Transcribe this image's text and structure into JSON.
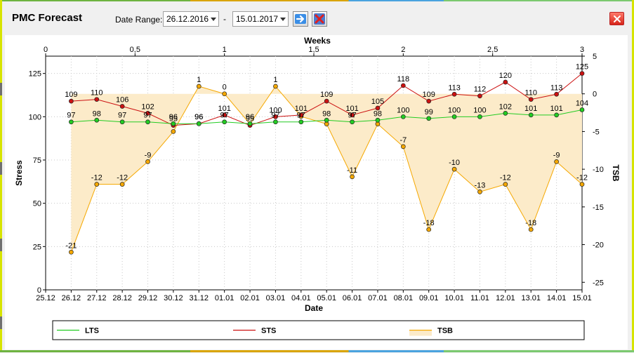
{
  "window": {
    "title": "PMC Forecast",
    "close_icon": "close-icon"
  },
  "toolbar": {
    "date_range_label": "Date Range:",
    "start_date": "26.12.2016",
    "separator": "-",
    "end_date": "15.01.2017",
    "apply_icon": "arrow-right-icon",
    "clear_icon": "red-x-icon"
  },
  "chart_data": {
    "type": "line",
    "title": "",
    "xlabel": "Date",
    "ylabel": "Stress",
    "y2label": "TSB",
    "top_axis_label": "Weeks",
    "categories": [
      "26.12",
      "27.12",
      "28.12",
      "29.12",
      "30.12",
      "31.12",
      "01.01",
      "02.01",
      "03.01",
      "04.01",
      "05.01",
      "06.01",
      "07.01",
      "08.01",
      "09.01",
      "10.01",
      "11.01",
      "12.01",
      "13.01",
      "14.01",
      "15.01"
    ],
    "x_tick_labels": [
      "25.12",
      "26.12",
      "27.12",
      "28.12",
      "29.12",
      "30.12",
      "31.12",
      "01.01",
      "02.01",
      "03.01",
      "04.01",
      "05.01",
      "06.01",
      "07.01",
      "08.01",
      "09.01",
      "10.01",
      "11.01",
      "12.01",
      "13.01",
      "14.01",
      "15.01"
    ],
    "top_tick_labels": [
      "0",
      "0,5",
      "1",
      "1,5",
      "2",
      "2,5",
      "3"
    ],
    "ylim": [
      0,
      135
    ],
    "y_ticks": [
      "0",
      "25",
      "50",
      "75",
      "100",
      "125"
    ],
    "y2lim": [
      -26,
      5
    ],
    "y2_ticks": [
      "5",
      "0",
      "-5",
      "-10",
      "-15",
      "-20",
      "-25"
    ],
    "grid": true,
    "legend_position": "bottom",
    "series": [
      {
        "name": "LTS",
        "axis": "left",
        "color": "#22cc22",
        "values": [
          97,
          98,
          97,
          97,
          96,
          96,
          97,
          96,
          97,
          97,
          98,
          97,
          98,
          100,
          99,
          100,
          100,
          102,
          101,
          101,
          104
        ],
        "labels": [
          "97",
          "98",
          "97",
          "97",
          "96",
          "96",
          "97",
          "96",
          "97",
          "97",
          "98",
          "97",
          "98",
          "100",
          "99",
          "100",
          "100",
          "102",
          "101",
          "101",
          "104"
        ]
      },
      {
        "name": "STS",
        "axis": "left",
        "color": "#cc1111",
        "values": [
          109,
          110,
          106,
          102,
          95,
          96,
          101,
          95,
          100,
          101,
          109,
          101,
          105,
          118,
          109,
          113,
          112,
          120,
          110,
          113,
          125
        ],
        "labels": [
          "109",
          "110",
          "106",
          "102",
          "95",
          "96",
          "101",
          "95",
          "100",
          "101",
          "109",
          "101",
          "105",
          "118",
          "109",
          "113",
          "112",
          "120",
          "110",
          "113",
          "125"
        ]
      },
      {
        "name": "TSB",
        "axis": "right",
        "color": "#f5a800",
        "fill": "#fcebc9",
        "values": [
          -21,
          -12,
          -12,
          -9,
          -5,
          1,
          0,
          -4,
          1,
          -3,
          -4,
          -11,
          -4,
          -7,
          -18,
          -10,
          -13,
          -12,
          -18,
          -9,
          -12
        ],
        "labels": [
          "-21",
          "-12",
          "-12",
          "-9",
          "",
          "1",
          "0",
          "",
          "1",
          "",
          "",
          "-11",
          "",
          "-7",
          "-18",
          "-10",
          "-13",
          "-12",
          "-18",
          "-9",
          "-12"
        ]
      }
    ]
  }
}
